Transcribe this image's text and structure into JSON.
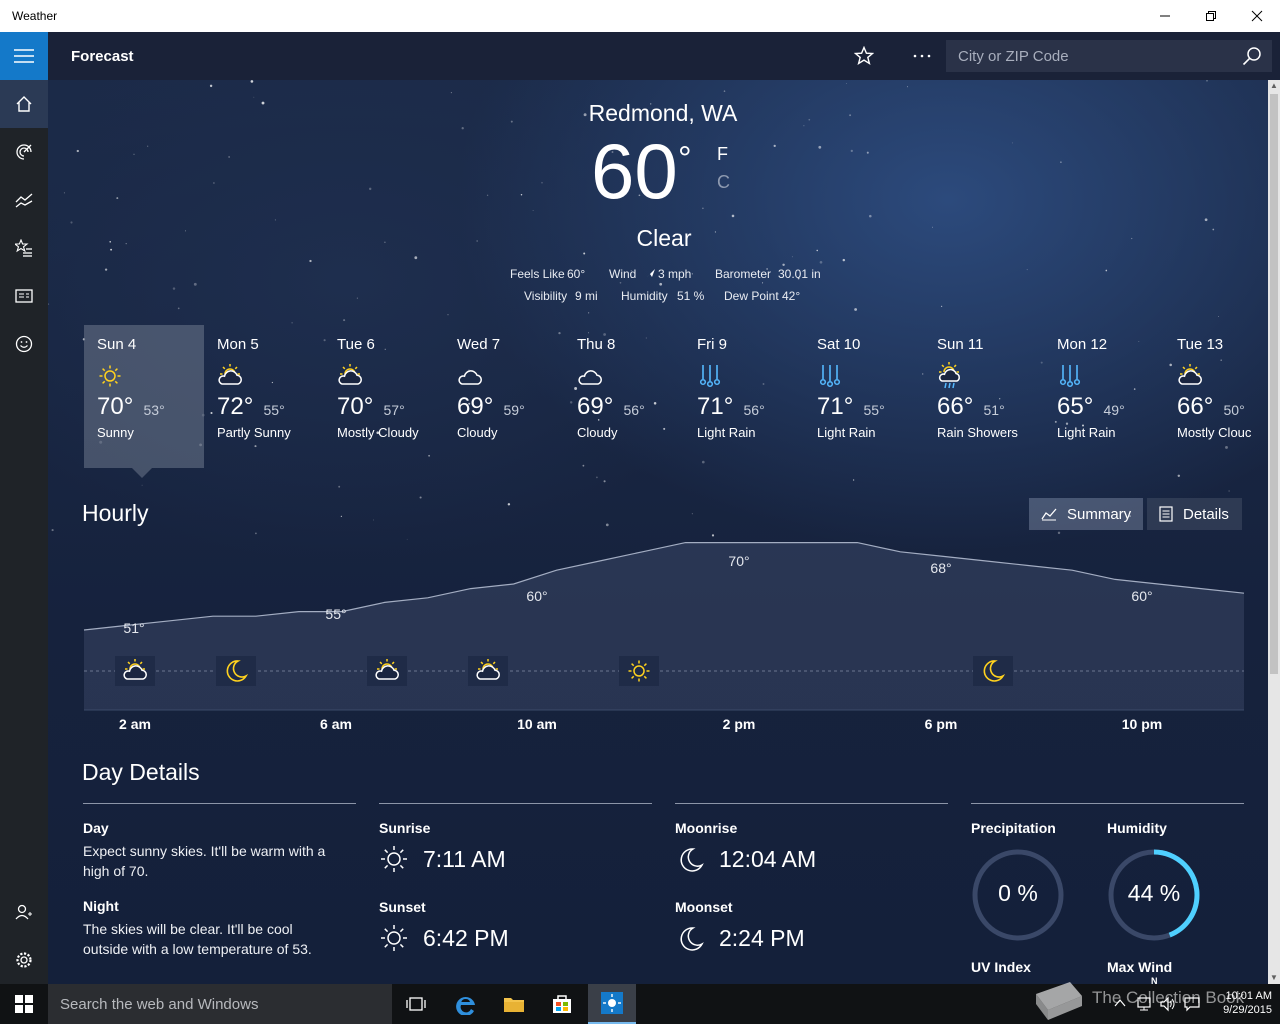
{
  "window": {
    "title": "Weather"
  },
  "header": {
    "title": "Forecast",
    "search_placeholder": "City or ZIP Code"
  },
  "current": {
    "location": "Redmond, WA",
    "temperature": "60",
    "degree_symbol": "°",
    "unit_f": "F",
    "unit_c": "C",
    "condition": "Clear",
    "feels_like_label": "Feels Like",
    "feels_like_value": "60°",
    "wind_label": "Wind",
    "wind_value": "3 mph",
    "barometer_label": "Barometer",
    "barometer_value": "30.01 in",
    "visibility_label": "Visibility",
    "visibility_value": "9 mi",
    "humidity_label": "Humidity",
    "humidity_value": "51 %",
    "dew_point_label": "Dew Point",
    "dew_point_value": "42°"
  },
  "daily": [
    {
      "day": "Sun 4",
      "high": "70°",
      "low": "53°",
      "condition": "Sunny",
      "icon": "sun-icon"
    },
    {
      "day": "Mon 5",
      "high": "72°",
      "low": "55°",
      "condition": "Partly Sunny",
      "icon": "partly-sunny-icon"
    },
    {
      "day": "Tue 6",
      "high": "70°",
      "low": "57°",
      "condition": "Mostly Cloudy",
      "icon": "mostly-cloudy-icon"
    },
    {
      "day": "Wed 7",
      "high": "69°",
      "low": "59°",
      "condition": "Cloudy",
      "icon": "cloud-icon"
    },
    {
      "day": "Thu 8",
      "high": "69°",
      "low": "56°",
      "condition": "Cloudy",
      "icon": "cloud-icon"
    },
    {
      "day": "Fri 9",
      "high": "71°",
      "low": "56°",
      "condition": "Light Rain",
      "icon": "rain-icon"
    },
    {
      "day": "Sat 10",
      "high": "71°",
      "low": "55°",
      "condition": "Light Rain",
      "icon": "rain-icon"
    },
    {
      "day": "Sun 11",
      "high": "66°",
      "low": "51°",
      "condition": "Rain Showers",
      "icon": "rain-showers-icon"
    },
    {
      "day": "Mon 12",
      "high": "65°",
      "low": "49°",
      "condition": "Light Rain",
      "icon": "rain-icon"
    },
    {
      "day": "Tue 13",
      "high": "66°",
      "low": "50°",
      "condition": "Mostly Clouc",
      "icon": "mostly-cloudy-icon"
    }
  ],
  "hourly": {
    "title": "Hourly",
    "summary_label": "Summary",
    "details_label": "Details",
    "time_labels": [
      "2 am",
      "6 am",
      "10 am",
      "2 pm",
      "6 pm",
      "10 pm"
    ],
    "temp_labels": [
      "51°",
      "55°",
      "60°",
      "70°",
      "68°",
      "60°"
    ],
    "temps": [
      51,
      52,
      53,
      54,
      54,
      55,
      55,
      57,
      58,
      60,
      61,
      64,
      66,
      68,
      70,
      70,
      70,
      70,
      70,
      68,
      67,
      66,
      65,
      64,
      62,
      61,
      60,
      59
    ],
    "icons": [
      "partly-cloudy-icon",
      "moon-icon",
      "partly-cloudy-icon",
      "partly-sunny-icon",
      "sun-icon",
      "moon-icon"
    ]
  },
  "day_details": {
    "title": "Day Details",
    "day_label": "Day",
    "day_text_1": "Expect sunny skies. It'll be warm with a",
    "day_text_2": "high of 70.",
    "night_label": "Night",
    "night_text_1": "The skies will be clear. It'll be cool",
    "night_text_2": "outside with a low temperature of 53.",
    "sunrise_label": "Sunrise",
    "sunrise_time": "7:11 AM",
    "sunset_label": "Sunset",
    "sunset_time": "6:42 PM",
    "moonrise_label": "Moonrise",
    "moonrise_time": "12:04 AM",
    "moonset_label": "Moonset",
    "moonset_time": "2:24 PM",
    "precipitation_label": "Precipitation",
    "precipitation_value": "0 %",
    "precipitation_fraction": 0,
    "humidity_label": "Humidity",
    "humidity_value": "44 %",
    "humidity_fraction": 0.44,
    "uv_label": "UV Index",
    "max_wind_label": "Max Wind",
    "compass_n": "N"
  },
  "taskbar": {
    "search_placeholder": "Search the web and Windows",
    "time": "10:01 AM",
    "date": "9/29/2015",
    "watermark": "The Collection Book"
  },
  "colors": {
    "accent": "#1479c9",
    "sun": "#ffd21e",
    "rain": "#55b9ff",
    "gauge": "#4fd0ff"
  }
}
